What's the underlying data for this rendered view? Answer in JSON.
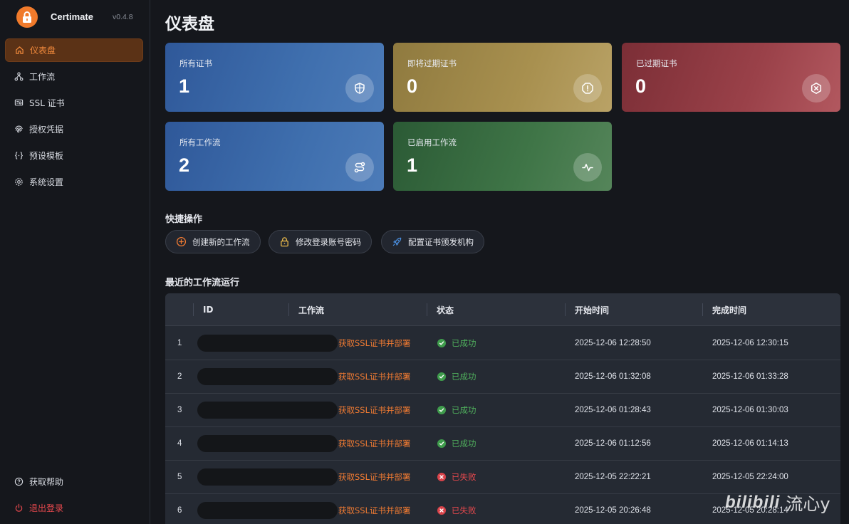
{
  "app": {
    "name": "Certimate",
    "version": "v0.4.8"
  },
  "sidebar": {
    "items": [
      {
        "label": "仪表盘",
        "icon": "home-icon",
        "active": true
      },
      {
        "label": "工作流",
        "icon": "workflow-icon"
      },
      {
        "label": "SSL 证书",
        "icon": "certificate-icon"
      },
      {
        "label": "授权凭据",
        "icon": "fingerprint-icon"
      },
      {
        "label": "预设模板",
        "icon": "braces-icon"
      },
      {
        "label": "系统设置",
        "icon": "gear-icon"
      }
    ],
    "footer": [
      {
        "label": "获取帮助",
        "icon": "help-icon"
      },
      {
        "label": "退出登录",
        "icon": "power-icon"
      }
    ]
  },
  "page": {
    "title": "仪表盘"
  },
  "stats": [
    {
      "label": "所有证书",
      "value": "1",
      "icon": "shield-icon",
      "color": "#3a66a6"
    },
    {
      "label": "即将过期证书",
      "value": "0",
      "icon": "alert-octagon-icon",
      "color": "#a38c4c"
    },
    {
      "label": "已过期证书",
      "value": "0",
      "icon": "x-hexagon-icon",
      "color": "#9a4149"
    },
    {
      "label": "所有工作流",
      "value": "2",
      "icon": "route-icon",
      "color": "#3a66a6"
    },
    {
      "label": "已启用工作流",
      "value": "1",
      "icon": "activity-icon",
      "color": "#3f7547"
    }
  ],
  "quick": {
    "title": "快捷操作",
    "actions": [
      {
        "label": "创建新的工作流",
        "icon": "plus-circle-icon"
      },
      {
        "label": "修改登录账号密码",
        "icon": "lock-icon"
      },
      {
        "label": "配置证书颁发机构",
        "icon": "rocket-icon"
      }
    ]
  },
  "runs": {
    "title": "最近的工作流运行",
    "columns": [
      "ID",
      "工作流",
      "状态",
      "开始时间",
      "完成时间"
    ],
    "rows": [
      {
        "index": "1",
        "workflow": "获取SSL证书并部署",
        "status": "已成功",
        "ok": true,
        "start": "2025-12-06 12:28:50",
        "end": "2025-12-06 12:30:15"
      },
      {
        "index": "2",
        "workflow": "获取SSL证书并部署",
        "status": "已成功",
        "ok": true,
        "start": "2025-12-06 01:32:08",
        "end": "2025-12-06 01:33:28"
      },
      {
        "index": "3",
        "workflow": "获取SSL证书并部署",
        "status": "已成功",
        "ok": true,
        "start": "2025-12-06 01:28:43",
        "end": "2025-12-06 01:30:03"
      },
      {
        "index": "4",
        "workflow": "获取SSL证书并部署",
        "status": "已成功",
        "ok": true,
        "start": "2025-12-06 01:12:56",
        "end": "2025-12-06 01:14:13"
      },
      {
        "index": "5",
        "workflow": "获取SSL证书并部署",
        "status": "已失败",
        "ok": false,
        "start": "2025-12-05 22:22:21",
        "end": "2025-12-05 22:24:00"
      },
      {
        "index": "6",
        "workflow": "获取SSL证书并部署",
        "status": "已失败",
        "ok": false,
        "start": "2025-12-05 20:26:48",
        "end": "2025-12-05 20:28:14"
      }
    ]
  },
  "watermark": {
    "logo": "bilibili",
    "text": "流心y"
  }
}
